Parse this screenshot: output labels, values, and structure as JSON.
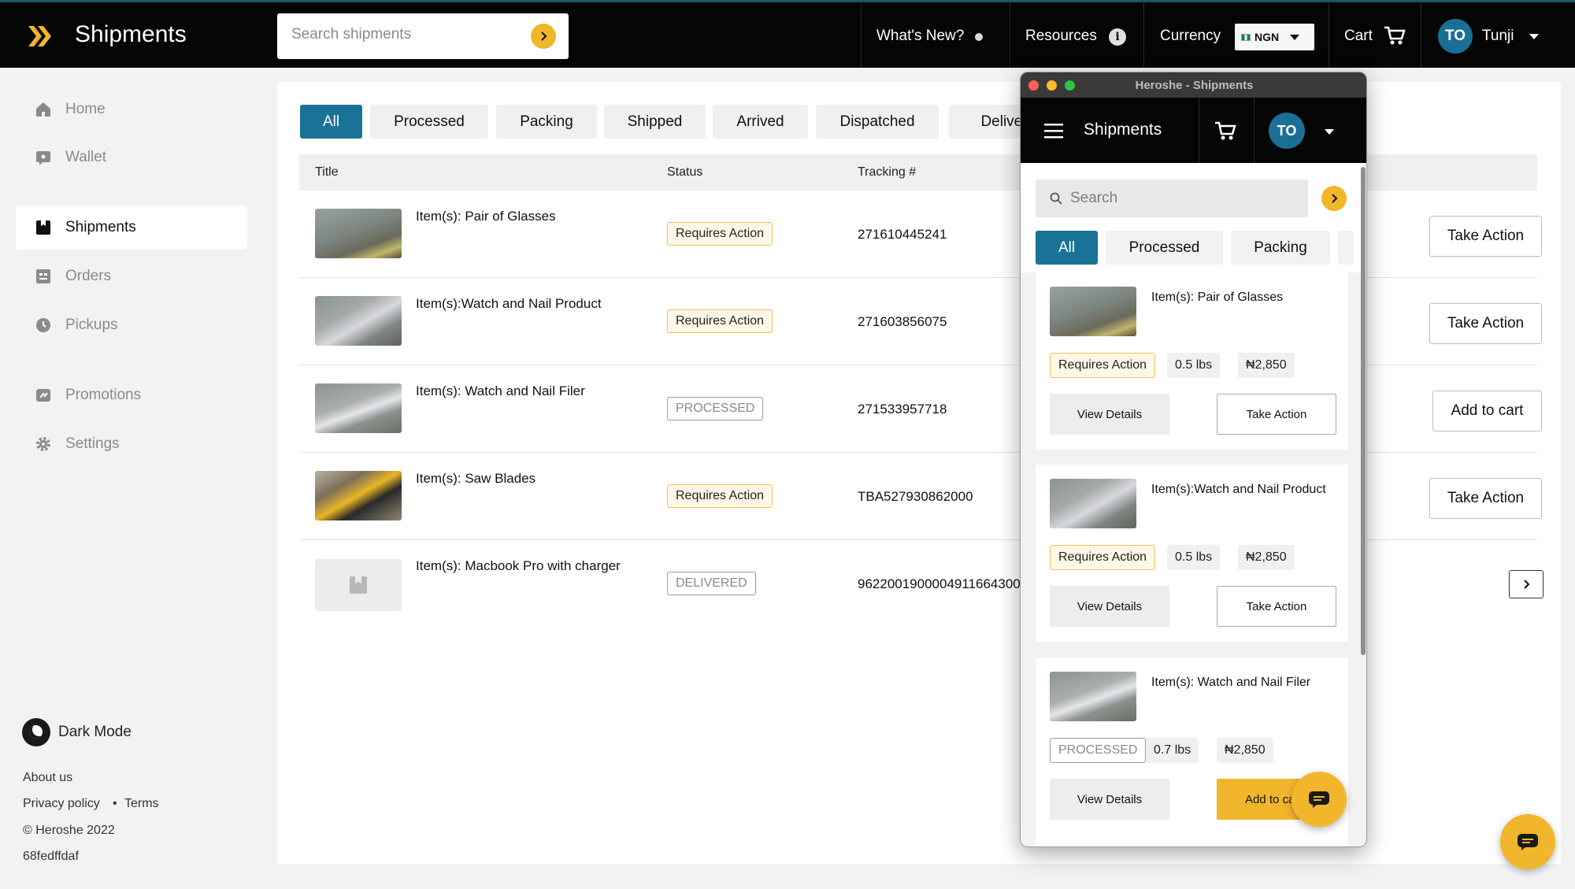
{
  "header": {
    "app_title": "Shipments",
    "search_placeholder": "Search shipments",
    "whats_new": "What's New?",
    "resources": "Resources",
    "currency_label": "Currency",
    "currency_value": "NGN",
    "cart": "Cart",
    "avatar_initials": "TO",
    "user_name": "Tunji"
  },
  "sidebar": {
    "items": [
      {
        "label": "Home",
        "icon": "home-icon"
      },
      {
        "label": "Wallet",
        "icon": "wallet-icon"
      },
      {
        "label": "Shipments",
        "icon": "shipments-icon",
        "active": true
      },
      {
        "label": "Orders",
        "icon": "orders-icon"
      },
      {
        "label": "Pickups",
        "icon": "pickups-icon"
      },
      {
        "label": "Promotions",
        "icon": "promotions-icon"
      },
      {
        "label": "Settings",
        "icon": "gear-icon"
      }
    ],
    "dark_mode": "Dark Mode",
    "about": "About us",
    "privacy": "Privacy policy",
    "bullet": "•",
    "terms": "Terms",
    "copyright": "© Heroshe 2022",
    "build": "68fedffdaf"
  },
  "tabs": [
    "All",
    "Processed",
    "Packing",
    "Shipped",
    "Arrived",
    "Dispatched",
    "Deliver"
  ],
  "table": {
    "columns": [
      "Title",
      "Status",
      "Tracking #"
    ],
    "rows": [
      {
        "title": "Item(s): Pair of Glasses",
        "status": "Requires Action",
        "tracking": "271610445241",
        "action": "Take Action"
      },
      {
        "title": "Item(s):Watch and Nail Product",
        "status": "Requires Action",
        "tracking": "271603856075",
        "action": "Take Action"
      },
      {
        "title": "Item(s): Watch and Nail Filer",
        "status": "PROCESSED",
        "tracking": "271533957718",
        "action": "Add to cart"
      },
      {
        "title": "Item(s): Saw Blades",
        "status": "Requires Action",
        "tracking": "TBA527930862000",
        "action": "Take Action"
      },
      {
        "title": "Item(s): Macbook Pro with charger",
        "status": "DELIVERED",
        "tracking": "9622001900004911664300"
      }
    ]
  },
  "mobile": {
    "window_title": "Heroshe - Shipments",
    "header_title": "Shipments",
    "avatar_initials": "TO",
    "search_placeholder": "Search",
    "tabs": [
      "All",
      "Processed",
      "Packing"
    ],
    "view_details": "View Details",
    "cards": [
      {
        "title": "Item(s): Pair of Glasses",
        "status": "Requires Action",
        "weight": "0.5 lbs",
        "price": "₦2,850",
        "action": "Take Action"
      },
      {
        "title": "Item(s):Watch and Nail Product",
        "status": "Requires Action",
        "weight": "0.5 lbs",
        "price": "₦2,850",
        "action": "Take Action"
      },
      {
        "title": "Item(s): Watch and Nail Filer",
        "status": "PROCESSED",
        "weight": "0.7 lbs",
        "price": "₦2,850",
        "action": "Add to ca"
      }
    ]
  },
  "colors": {
    "accent": "#1a7396",
    "brand_yellow": "#f1b62b",
    "topbar": "#050505"
  }
}
